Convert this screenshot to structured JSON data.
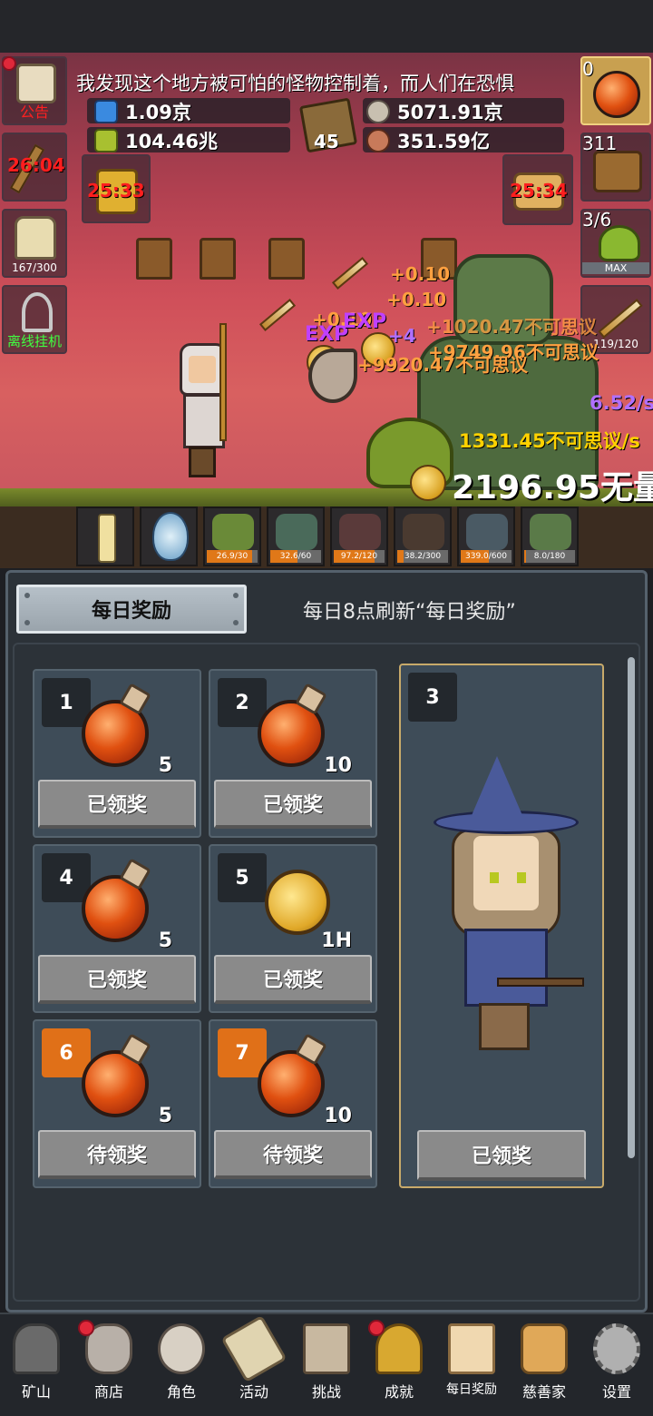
{
  "ticker": "我发现这个地方被可怕的怪物控制着，而人们在恐惧",
  "resources": {
    "potion_blue": "1.09京",
    "potion_green": "104.46兆",
    "book_count": "45",
    "stone": "5071.91京",
    "meat": "351.59亿"
  },
  "left_side": {
    "notice_label": "公告",
    "torch_timer": "26:04",
    "beer_count": "167/300",
    "offline_label": "离线挂机",
    "golden_chest_timer": "25:33"
  },
  "right_side": {
    "potion_count": "0",
    "chest_count": "311",
    "slime_count": "3/6",
    "slime_badge": "MAX",
    "sword_count": "119/120",
    "chest_timer": "25:34"
  },
  "battle": {
    "float_texts": [
      "+0.10",
      "+0.10",
      "+0.10",
      "EXP",
      "EXP",
      "+4",
      "+9749.96不可思议",
      "+9920.47不可思议",
      "+1020.47不可思议"
    ],
    "dps_purple": "6.52/s",
    "dps_gold": "1331.45不可思议/s",
    "gold_total": "2196.95无量"
  },
  "monsters": [
    {
      "hp": "26.9/30",
      "fill": 0.9,
      "color": "#6a8a38"
    },
    {
      "hp": "32.6/60",
      "fill": 0.54,
      "color": "#4a6a5a"
    },
    {
      "hp": "97.2/120",
      "fill": 0.81,
      "color": "#5a3a3a"
    },
    {
      "hp": "38.2/300",
      "fill": 0.13,
      "color": "#4a3a30"
    },
    {
      "hp": "339.0/600",
      "fill": 0.56,
      "color": "#4a5a64"
    },
    {
      "hp": "8.0/180",
      "fill": 0.04,
      "color": "#5a7a48"
    }
  ],
  "reward": {
    "tab_label": "每日奖励",
    "refresh_note": "每日8点刷新“每日奖励”",
    "cards": [
      {
        "num": "1",
        "item": "potion",
        "qty": "5",
        "btn": "已领奖",
        "pending": false
      },
      {
        "num": "2",
        "item": "potion",
        "qty": "10",
        "btn": "已领奖",
        "pending": false
      },
      {
        "num": "4",
        "item": "potion",
        "qty": "5",
        "btn": "已领奖",
        "pending": false
      },
      {
        "num": "5",
        "item": "coin",
        "qty": "1H",
        "btn": "已领奖",
        "pending": false
      },
      {
        "num": "6",
        "item": "potion",
        "qty": "5",
        "btn": "待领奖",
        "pending": true
      },
      {
        "num": "7",
        "item": "potion",
        "qty": "10",
        "btn": "待领奖",
        "pending": true
      }
    ],
    "big_card": {
      "num": "3",
      "btn": "已领奖"
    }
  },
  "nav": [
    {
      "label": "矿山",
      "icon": "lantern-icon",
      "dot": false
    },
    {
      "label": "商店",
      "icon": "shop-icon",
      "dot": true
    },
    {
      "label": "角色",
      "icon": "skull-icon",
      "dot": false
    },
    {
      "label": "活动",
      "icon": "scroll-icon",
      "dot": false
    },
    {
      "label": "挑战",
      "icon": "map-icon",
      "dot": false
    },
    {
      "label": "成就",
      "icon": "key-icon",
      "dot": true
    },
    {
      "label": "每日奖励",
      "icon": "envelope-icon",
      "dot": false
    },
    {
      "label": "慈善家",
      "icon": "bread-icon",
      "dot": false
    },
    {
      "label": "设置",
      "icon": "gear-icon",
      "dot": false
    }
  ]
}
